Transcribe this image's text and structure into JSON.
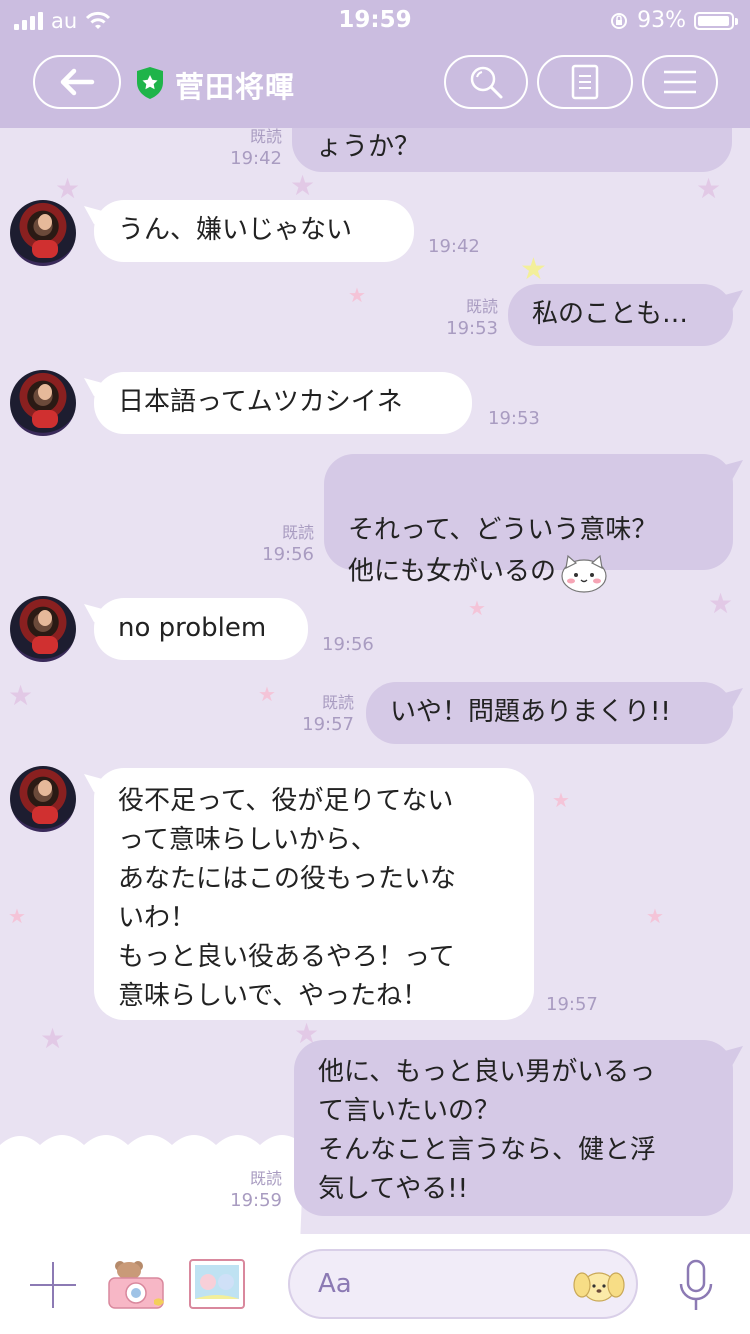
{
  "status_bar": {
    "carrier": "au",
    "time": "19:59",
    "battery": "93%"
  },
  "header": {
    "title": "菅田将暉",
    "icons": [
      "back-arrow-icon",
      "verified-shield-icon",
      "search-icon",
      "notes-icon",
      "menu-icon"
    ]
  },
  "messages": [
    {
      "dir": "out",
      "text": "ょうか？",
      "read": "既読",
      "time": "19:42"
    },
    {
      "dir": "in",
      "text": "うん、嫌いじゃない",
      "time": "19:42"
    },
    {
      "dir": "out",
      "text": "私のことも…",
      "read": "既読",
      "time": "19:53"
    },
    {
      "dir": "in",
      "text": "日本語ってムツカシイネ",
      "time": "19:53"
    },
    {
      "dir": "out",
      "text": "それって、どういう意味？\n他にも女がいるの",
      "read": "既読",
      "time": "19:56",
      "sticker": "cat-emoji"
    },
    {
      "dir": "in",
      "text": "no problem",
      "time": "19:56"
    },
    {
      "dir": "out",
      "text": "いや！問題ありまくり!!",
      "read": "既読",
      "time": "19:57"
    },
    {
      "dir": "in",
      "text": "役不足って、役が足りてない\nって意味らしいから、\nあなたにはこの役もったいな\nいわ！\nもっと良い役あるやろ！って\n意味らしいで、やったね！",
      "time": "19:57"
    },
    {
      "dir": "out",
      "text": "他に、もっと良い男がいるっ\nて言いたいの？\nそんなこと言うなら、健と浮\n気してやる!!",
      "read": "既読",
      "time": "19:59"
    }
  ],
  "input": {
    "placeholder": "Aa"
  },
  "colors": {
    "header": "#cbbde0",
    "background": "#e9e2f2",
    "outgoing_bubble": "#d5c9e6",
    "incoming_bubble": "#ffffff",
    "meta_text": "#a99cc1",
    "accent": "#8c7ab4"
  }
}
